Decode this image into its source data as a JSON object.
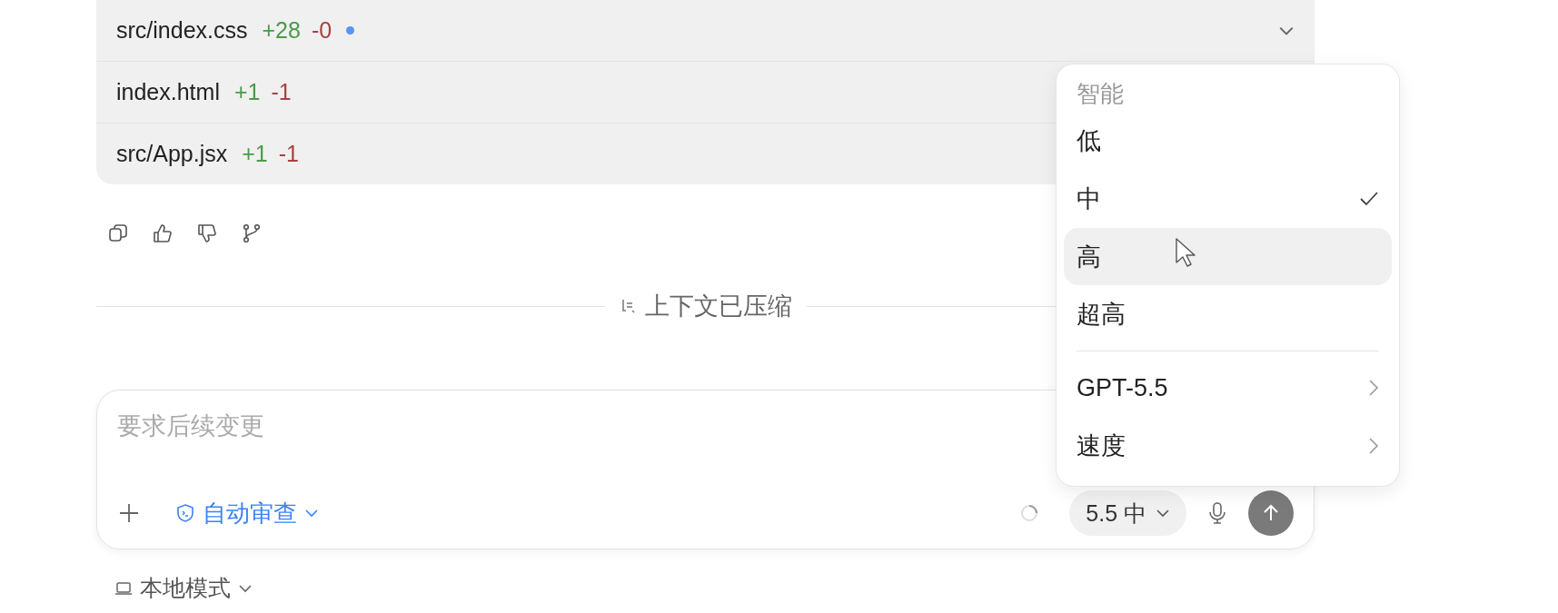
{
  "changed_files": [
    {
      "path": "src/index.css",
      "added": "+28",
      "removed": "-0",
      "unsaved": true
    },
    {
      "path": "index.html",
      "added": "+1",
      "removed": "-1",
      "unsaved": false
    },
    {
      "path": "src/App.jsx",
      "added": "+1",
      "removed": "-1",
      "unsaved": false
    }
  ],
  "divider_label": "上下文已压缩",
  "composer": {
    "placeholder": "要求后续变更",
    "approval": "自动审查",
    "model_button": "5.5 中"
  },
  "footer": {
    "mode": "本地模式"
  },
  "menu": {
    "header": "智能",
    "options": [
      {
        "label": "低",
        "selected": false,
        "hovered": false
      },
      {
        "label": "中",
        "selected": true,
        "hovered": false
      },
      {
        "label": "高",
        "selected": false,
        "hovered": true
      },
      {
        "label": "超高",
        "selected": false,
        "hovered": false
      }
    ],
    "submenus": [
      {
        "label": "GPT-5.5"
      },
      {
        "label": "速度"
      }
    ]
  }
}
